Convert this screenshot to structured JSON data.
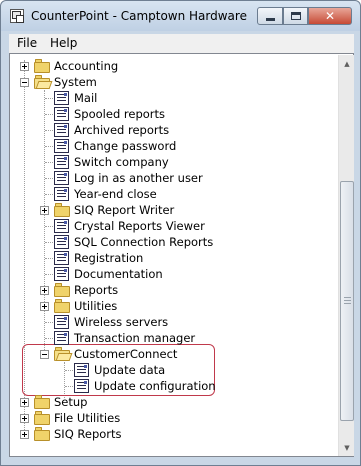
{
  "window": {
    "title": "CounterPoint - Camptown Hardware",
    "controls": {
      "minimize": "",
      "maximize": "",
      "close": "✕"
    }
  },
  "menubar": {
    "items": [
      "File",
      "Help"
    ]
  },
  "tree": {
    "nodes": [
      {
        "label": "Accounting",
        "type": "folder",
        "expander": "plus"
      },
      {
        "label": "System",
        "type": "folder-open",
        "expander": "minus"
      },
      {
        "label": "Mail",
        "type": "doc"
      },
      {
        "label": "Spooled reports",
        "type": "doc"
      },
      {
        "label": "Archived reports",
        "type": "doc"
      },
      {
        "label": "Change password",
        "type": "doc"
      },
      {
        "label": "Switch company",
        "type": "doc"
      },
      {
        "label": "Log in as another user",
        "type": "doc"
      },
      {
        "label": "Year-end close",
        "type": "doc"
      },
      {
        "label": "SIQ Report Writer",
        "type": "folder",
        "expander": "plus"
      },
      {
        "label": "Crystal Reports Viewer",
        "type": "doc"
      },
      {
        "label": "SQL Connection Reports",
        "type": "doc"
      },
      {
        "label": "Registration",
        "type": "doc"
      },
      {
        "label": "Documentation",
        "type": "doc"
      },
      {
        "label": "Reports",
        "type": "folder",
        "expander": "plus"
      },
      {
        "label": "Utilities",
        "type": "folder",
        "expander": "plus"
      },
      {
        "label": "Wireless servers",
        "type": "doc"
      },
      {
        "label": "Transaction manager",
        "type": "doc"
      },
      {
        "label": "CustomerConnect",
        "type": "folder-open",
        "expander": "minus"
      },
      {
        "label": "Update data",
        "type": "doc"
      },
      {
        "label": "Update configuration",
        "type": "doc"
      },
      {
        "label": "Setup",
        "type": "folder",
        "expander": "plus"
      },
      {
        "label": "File Utilities",
        "type": "folder",
        "expander": "plus"
      },
      {
        "label": "SIQ Reports",
        "type": "folder",
        "expander": "plus"
      }
    ]
  },
  "colors": {
    "highlight_border": "#c0394b",
    "folder": "#f0d36a"
  }
}
